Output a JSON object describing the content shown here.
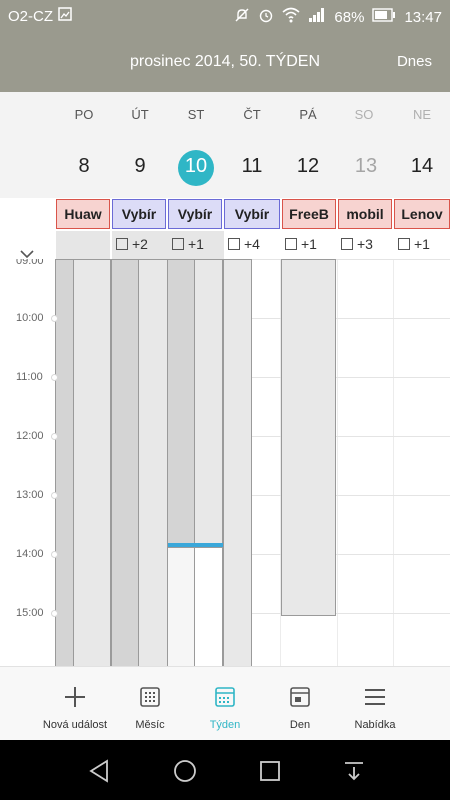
{
  "status_bar": {
    "carrier": "O2-CZ",
    "battery": "68%",
    "time": "13:47"
  },
  "header": {
    "title": "prosinec 2014, 50. TÝDEN",
    "today_button": "Dnes"
  },
  "week": {
    "days": [
      {
        "name": "PO",
        "date": "8",
        "weekend": false
      },
      {
        "name": "ÚT",
        "date": "9",
        "weekend": false
      },
      {
        "name": "ST",
        "date": "10",
        "weekend": false,
        "today": true
      },
      {
        "name": "ČT",
        "date": "11",
        "weekend": false
      },
      {
        "name": "PÁ",
        "date": "12",
        "weekend": false
      },
      {
        "name": "SO",
        "date": "13",
        "weekend": true
      },
      {
        "name": "NE",
        "date": "14",
        "weekend": true
      }
    ]
  },
  "all_day": {
    "events": [
      {
        "title": "Huaw",
        "day": 0,
        "bg": "#f7d3d0",
        "border": "#d9544a"
      },
      {
        "title": "Vybír",
        "day": 1,
        "bg": "#dcdcf7",
        "border": "#6b6bd6"
      },
      {
        "title": "Vybír",
        "day": 2,
        "bg": "#dcdcf7",
        "border": "#6b6bd6"
      },
      {
        "title": "Vybír",
        "day": 3,
        "bg": "#dcdcf7",
        "border": "#6b6bd6"
      },
      {
        "title": "FreeB",
        "day": 4,
        "bg": "#f7d3d0",
        "border": "#d9544a"
      },
      {
        "title": "mobil",
        "day": 5,
        "bg": "#f7d3d0",
        "border": "#d9544a"
      },
      {
        "title": "Lenov",
        "day": 6,
        "bg": "#f7d3d0",
        "border": "#d9544a"
      }
    ],
    "more": [
      {
        "day": 1,
        "label": "+2"
      },
      {
        "day": 2,
        "label": "+1"
      },
      {
        "day": 3,
        "label": "+4"
      },
      {
        "day": 4,
        "label": "+1"
      },
      {
        "day": 5,
        "label": "+3"
      },
      {
        "day": 6,
        "label": "+1"
      }
    ]
  },
  "time_labels": [
    "09:00",
    "10:00",
    "11:00",
    "12:00",
    "13:00",
    "14:00",
    "15:00"
  ],
  "bottom_nav": [
    {
      "label": "Nová událost",
      "icon": "plus-icon"
    },
    {
      "label": "Měsíc",
      "icon": "month-grid-icon"
    },
    {
      "label": "Týden",
      "icon": "week-calendar-icon",
      "active": true
    },
    {
      "label": "Den",
      "icon": "day-calendar-icon"
    },
    {
      "label": "Nabídka",
      "icon": "menu-icon"
    }
  ],
  "colors": {
    "accent": "#2fb6c6",
    "header": "#9a9a8e",
    "now_line": "#3aa7d9"
  }
}
